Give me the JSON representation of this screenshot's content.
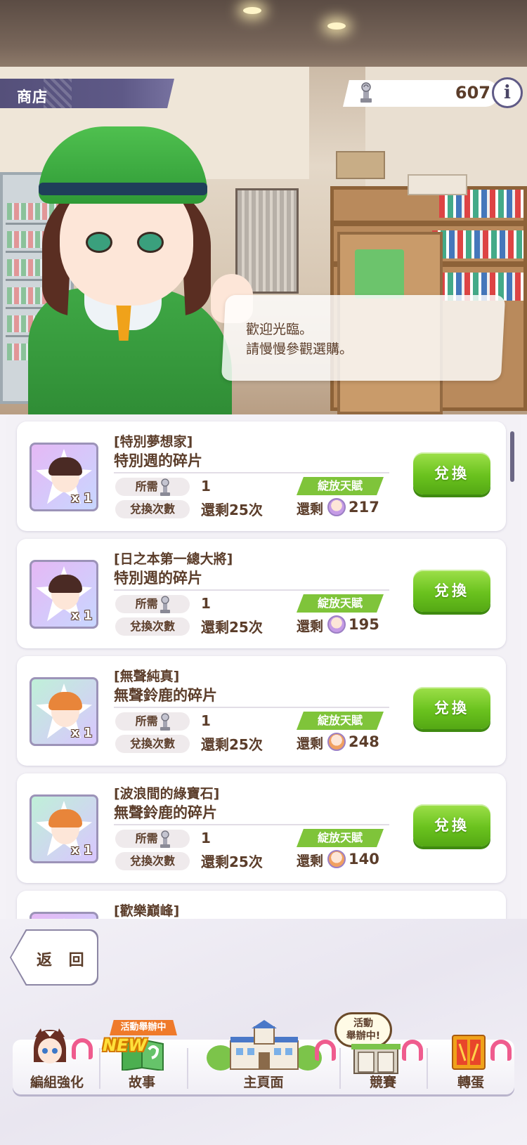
{
  "header": {
    "title": "商店",
    "currency_value": "607",
    "info_label": "i"
  },
  "dialog": {
    "line1": "歡迎光臨。",
    "line2": "請慢慢參觀選購。"
  },
  "labels": {
    "required": "所需",
    "exchange_count": "兌換次數",
    "bloom": "綻放天賦",
    "stock": "還剩",
    "exchange_button": "兌換"
  },
  "items": [
    {
      "subtitle": "[特別夢想家]",
      "name": "特別週的碎片",
      "qty": "x 1",
      "cost": "1",
      "remaining": "還剩25次",
      "stock": "217",
      "hair": "#4a2a24"
    },
    {
      "subtitle": "[日之本第一總大將]",
      "name": "特別週的碎片",
      "qty": "x 1",
      "cost": "1",
      "remaining": "還剩25次",
      "stock": "195",
      "hair": "#4a2a24"
    },
    {
      "subtitle": "[無聲純真]",
      "name": "無聲鈴鹿的碎片",
      "qty": "x 1",
      "cost": "1",
      "remaining": "還剩25次",
      "stock": "248",
      "hair": "#e8853a"
    },
    {
      "subtitle": "[波浪間的綠寶石]",
      "name": "無聲鈴鹿的碎片",
      "qty": "x 1",
      "cost": "1",
      "remaining": "還剩25次",
      "stock": "140",
      "hair": "#e8853a"
    },
    {
      "subtitle": "[歡樂巔峰]"
    }
  ],
  "back_button": "返 回",
  "tabs": [
    {
      "label": "編組強化"
    },
    {
      "label": "故事",
      "badge": "活動舉辦中",
      "new": "NEW"
    },
    {
      "label": "主頁面"
    },
    {
      "label": "競賽",
      "bubble1": "活動",
      "bubble2": "舉辦中!"
    },
    {
      "label": "轉蛋"
    }
  ],
  "colors": {
    "accent_green": "#6ac21e",
    "banner_purple": "#55507a",
    "text_brown": "#5b3d2a",
    "badge_pink": "#ef5c8e"
  }
}
